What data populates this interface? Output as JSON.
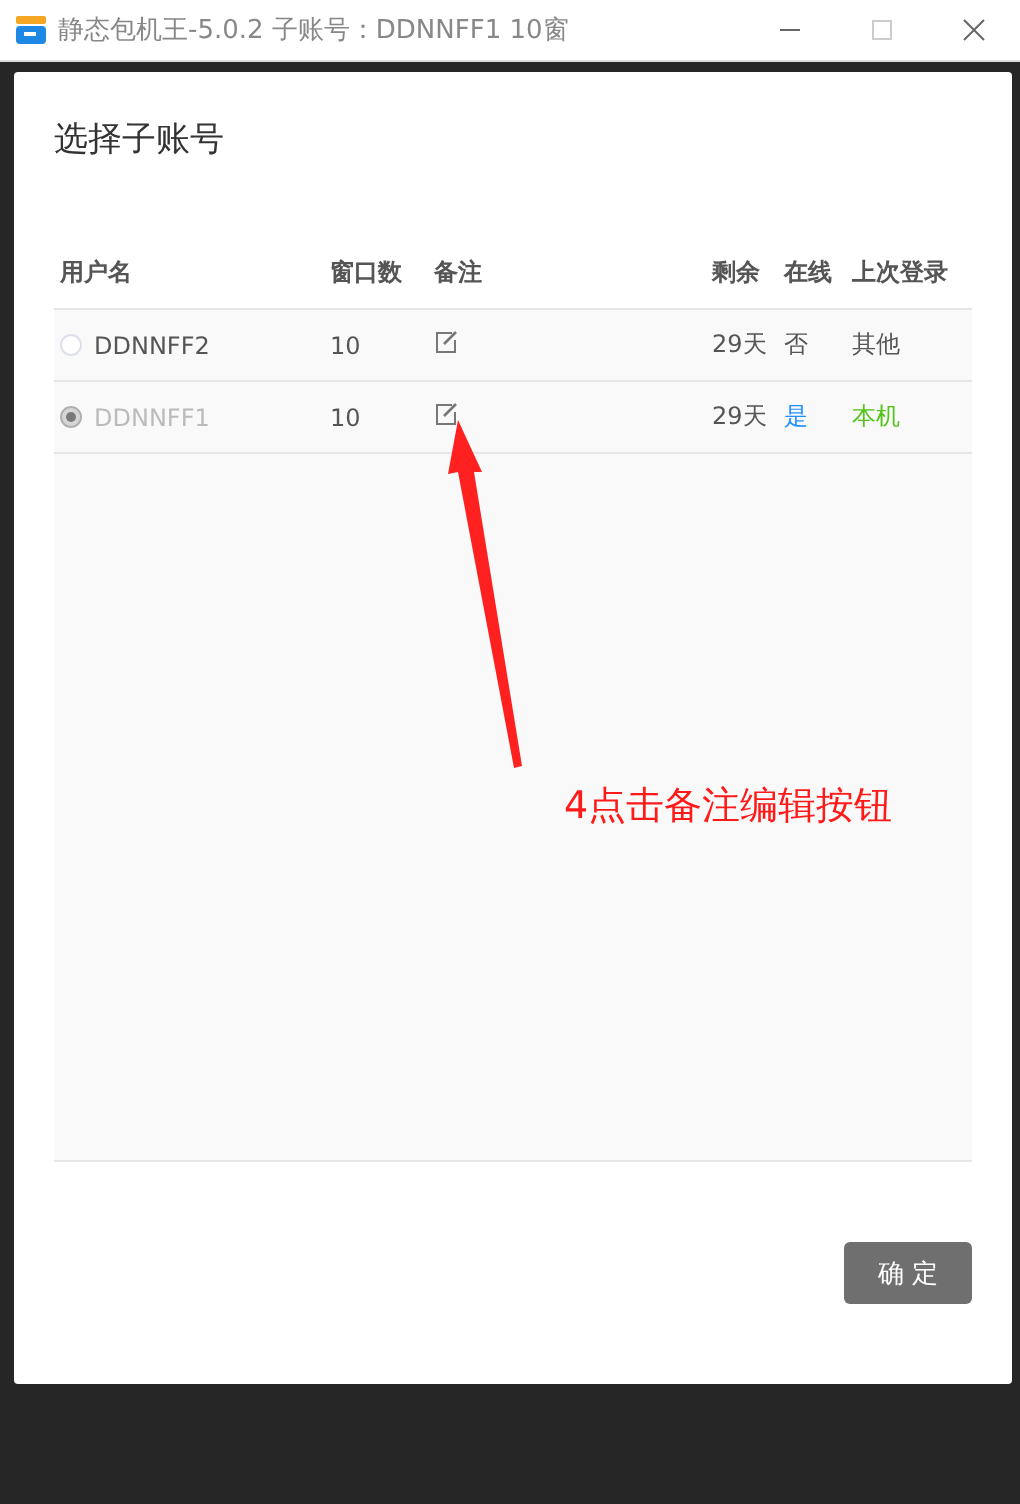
{
  "window": {
    "title": "静态包机王-5.0.2 子账号：DDNNFF1 10窗"
  },
  "dialog": {
    "title": "选择子账号",
    "table": {
      "columns": [
        "用户名",
        "窗口数",
        "备注",
        "剩余",
        "在线",
        "上次登录"
      ],
      "rows": [
        {
          "selected": false,
          "disabled": false,
          "name": "DDNNFF2",
          "windows": "10",
          "remaining": "29天",
          "online": false,
          "online_text": "否",
          "local": false,
          "last_login": "其他"
        },
        {
          "selected": true,
          "disabled": true,
          "name": "DDNNFF1",
          "windows": "10",
          "remaining": "29天",
          "online": true,
          "online_text": "是",
          "local": true,
          "last_login": "本机"
        }
      ]
    },
    "confirm_button": "确 定"
  },
  "annotation": {
    "text": "4点击备注编辑按钮"
  }
}
